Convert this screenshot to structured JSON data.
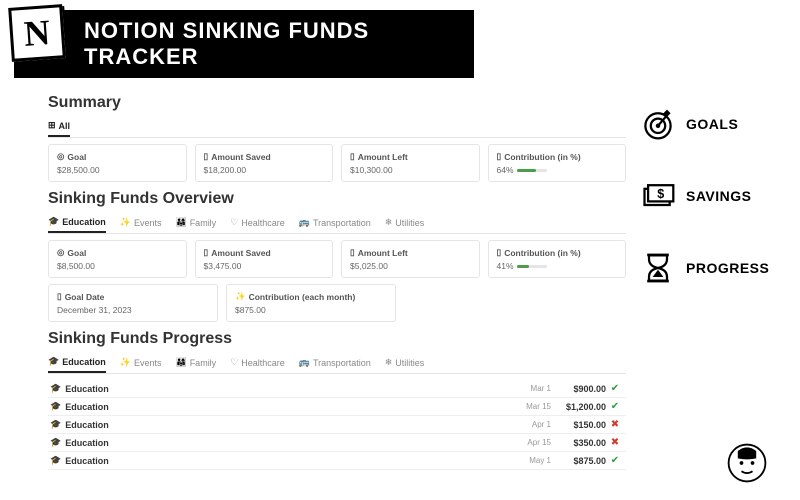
{
  "header": {
    "logo_letter": "N",
    "title": "NOTION SINKING FUNDS TRACKER"
  },
  "features": [
    {
      "icon": "target-icon",
      "label": "GOALS"
    },
    {
      "icon": "money-icon",
      "label": "SAVINGS"
    },
    {
      "icon": "hourglass-icon",
      "label": "PROGRESS"
    }
  ],
  "summary": {
    "title": "Summary",
    "tab_all": "All",
    "cards": {
      "goal_label": "Goal",
      "goal_value": "$28,500.00",
      "saved_label": "Amount Saved",
      "saved_value": "$18,200.00",
      "left_label": "Amount Left",
      "left_value": "$10,300.00",
      "contrib_label": "Contribution (in %)",
      "contrib_value": "64%",
      "contrib_pct": 64
    }
  },
  "overview": {
    "title": "Sinking Funds Overview",
    "tabs": [
      {
        "icon": "🎓",
        "label": "Education",
        "active": true
      },
      {
        "icon": "✨",
        "label": "Events"
      },
      {
        "icon": "👨‍👩‍👧",
        "label": "Family"
      },
      {
        "icon": "♡",
        "label": "Healthcare"
      },
      {
        "icon": "🚌",
        "label": "Transportation"
      },
      {
        "icon": "❄",
        "label": "Utilities"
      }
    ],
    "cards": {
      "goal_label": "Goal",
      "goal_value": "$8,500.00",
      "saved_label": "Amount Saved",
      "saved_value": "$3,475.00",
      "left_label": "Amount Left",
      "left_value": "$5,025.00",
      "contrib_label": "Contribution (in %)",
      "contrib_value": "41%",
      "contrib_pct": 41,
      "date_label": "Goal Date",
      "date_value": "December 31, 2023",
      "monthly_label": "Contribution (each month)",
      "monthly_value": "$875.00"
    }
  },
  "progress": {
    "title": "Sinking Funds Progress",
    "tabs": [
      {
        "icon": "🎓",
        "label": "Education",
        "active": true
      },
      {
        "icon": "✨",
        "label": "Events"
      },
      {
        "icon": "👨‍👩‍👧",
        "label": "Family"
      },
      {
        "icon": "♡",
        "label": "Healthcare"
      },
      {
        "icon": "🚌",
        "label": "Transportation"
      },
      {
        "icon": "❄",
        "label": "Utilities"
      }
    ],
    "rows": [
      {
        "icon": "🎓",
        "label": "Education",
        "date": "Mar 1",
        "amount": "$900.00",
        "ok": true
      },
      {
        "icon": "🎓",
        "label": "Education",
        "date": "Mar 15",
        "amount": "$1,200.00",
        "ok": true
      },
      {
        "icon": "🎓",
        "label": "Education",
        "date": "Apr 1",
        "amount": "$150.00",
        "ok": false
      },
      {
        "icon": "🎓",
        "label": "Education",
        "date": "Apr 15",
        "amount": "$350.00",
        "ok": false
      },
      {
        "icon": "🎓",
        "label": "Education",
        "date": "May 1",
        "amount": "$875.00",
        "ok": true
      }
    ]
  }
}
